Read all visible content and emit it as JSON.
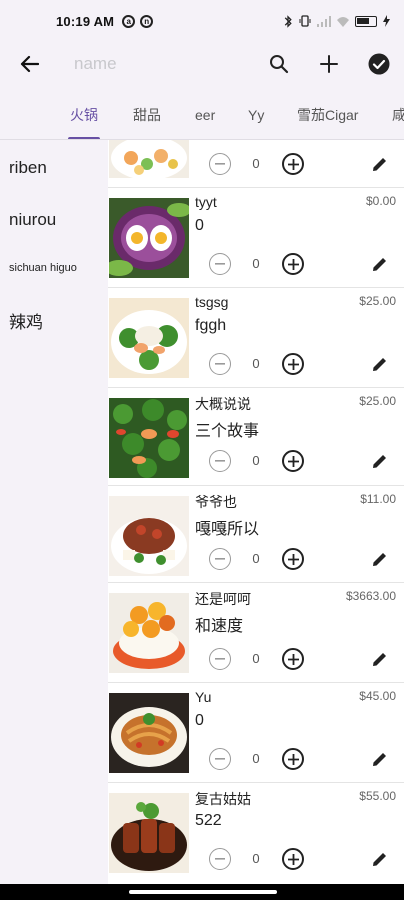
{
  "status_bar": {
    "time": "10:19 AM",
    "left_icons": [
      "alarm-icon",
      "no-sim-icon"
    ],
    "right_icons": [
      "bluetooth-icon",
      "vibrate-icon",
      "signal-icon",
      "wifi-icon",
      "battery-icon",
      "charging-icon"
    ],
    "battery_label": "51"
  },
  "app_bar": {
    "search_placeholder": "name",
    "search_value": ""
  },
  "tabs": [
    {
      "label": "火锅",
      "active": true
    },
    {
      "label": "甜品",
      "active": false
    },
    {
      "label": "eer",
      "active": false
    },
    {
      "label": "Yy",
      "active": false
    },
    {
      "label": "雪茄Cigar",
      "active": false
    },
    {
      "label": "咸",
      "active": false
    }
  ],
  "categories": [
    {
      "label": "riben"
    },
    {
      "label": "niurou"
    },
    {
      "label": "sichuan higuo"
    },
    {
      "label": "辣鸡"
    }
  ],
  "items": [
    {
      "name": "",
      "desc": "",
      "price": "",
      "qty": "0",
      "image": "shrimp-dish"
    },
    {
      "name": "tyyt",
      "desc": "0",
      "price": "$0.00",
      "qty": "0",
      "image": "egg-salad"
    },
    {
      "name": "tsgsg",
      "desc": "fggh",
      "price": "$25.00",
      "qty": "0",
      "image": "broccoli-seafood"
    },
    {
      "name": "大概说说",
      "desc": "三个故事",
      "price": "$25.00",
      "qty": "0",
      "image": "shrimp-vegetables"
    },
    {
      "name": "爷爷也",
      "desc": "嘎嘎所以",
      "price": "$11.00",
      "qty": "0",
      "image": "beef-tofu"
    },
    {
      "name": "还是呵呵",
      "desc": "和速度",
      "price": "$3663.00",
      "qty": "0",
      "image": "mango-rice"
    },
    {
      "name": "Yu",
      "desc": "0",
      "price": "$45.00",
      "qty": "0",
      "image": "noodles"
    },
    {
      "name": "复古姑姑",
      "desc": "522",
      "price": "$55.00",
      "qty": "0",
      "image": "braised-pork"
    }
  ],
  "colors": {
    "accent": "#6750a4",
    "surface": "#f5f2f8",
    "divider": "#e4e4e4"
  }
}
